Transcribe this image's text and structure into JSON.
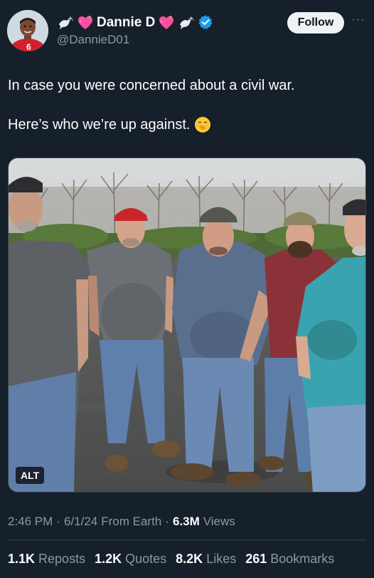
{
  "user": {
    "display_name": "Dannie D",
    "handle": "@DannieD01",
    "verified": true,
    "name_emojis": [
      "dove-icon",
      "sparkling-heart-icon",
      "sparkling-heart-icon",
      "dove-icon"
    ]
  },
  "actions": {
    "follow_label": "Follow",
    "more_label": "···"
  },
  "tweet": {
    "line1": "In case you were concerned about a civil war.",
    "line2": "Here’s who we’re up against.",
    "line2_emoji": "face-with-hand-over-mouth-icon"
  },
  "media": {
    "alt_label": "ALT"
  },
  "meta": {
    "time": "2:46 PM",
    "date": "6/1/24",
    "source": "From Earth",
    "views_count": "6.3M",
    "views_label": "Views",
    "separator": "·"
  },
  "stats": [
    {
      "count": "1.1K",
      "label": "Reposts"
    },
    {
      "count": "1.2K",
      "label": "Quotes"
    },
    {
      "count": "8.2K",
      "label": "Likes"
    },
    {
      "count": "261",
      "label": "Bookmarks"
    }
  ],
  "colors": {
    "background": "#15202b",
    "secondary_text": "#8b98a5",
    "verified_blue": "#1d9bf0",
    "heart_pink": "#ff4fa0"
  }
}
